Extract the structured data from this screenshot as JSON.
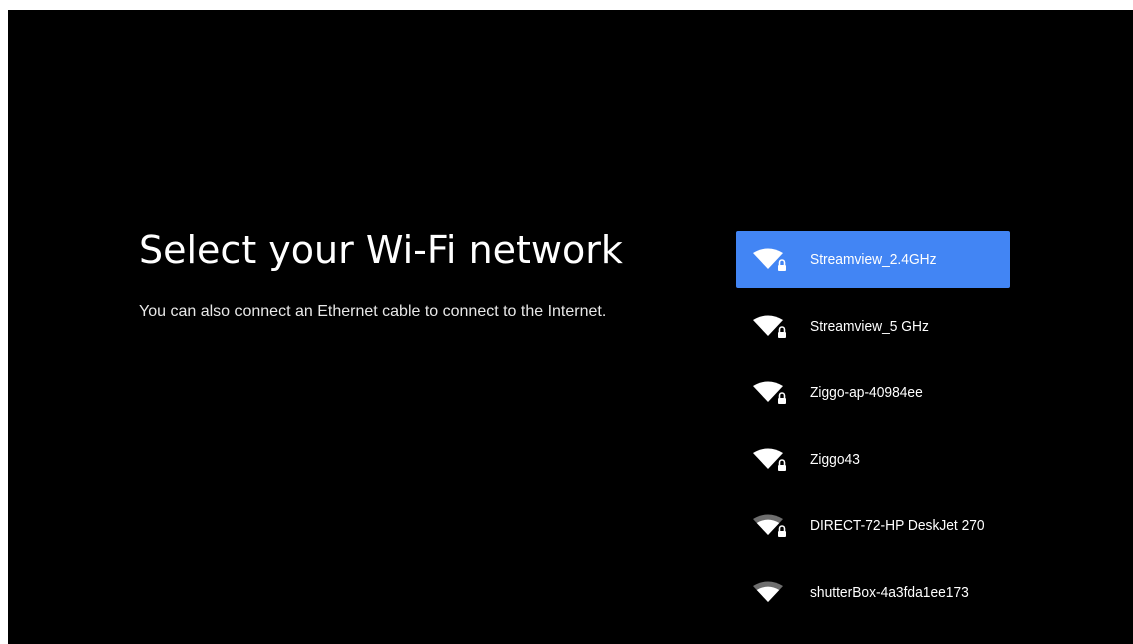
{
  "page": {
    "title": "Select your Wi-Fi network",
    "subtitle": "You can also connect an Ethernet cable to connect to the Internet."
  },
  "networks": [
    {
      "name": "Streamview_2.4GHz",
      "signal_bars": 4,
      "locked": true,
      "selected": true
    },
    {
      "name": "Streamview_5 GHz",
      "signal_bars": 4,
      "locked": true,
      "selected": false
    },
    {
      "name": "Ziggo-ap-40984ee",
      "signal_bars": 4,
      "locked": true,
      "selected": false
    },
    {
      "name": "Ziggo43",
      "signal_bars": 4,
      "locked": true,
      "selected": false
    },
    {
      "name": "DIRECT-72-HP DeskJet 270",
      "signal_bars": 3,
      "locked": true,
      "selected": false
    },
    {
      "name": "shutterBox-4a3fda1ee173",
      "signal_bars": 3,
      "locked": false,
      "selected": false
    }
  ],
  "colors": {
    "background": "#000000",
    "selected": "#4285f4",
    "text": "#ffffff",
    "weak_signal": "#6e6e6e"
  },
  "icons": {
    "wifi": "wifi-icon",
    "lock": "lock-icon"
  }
}
